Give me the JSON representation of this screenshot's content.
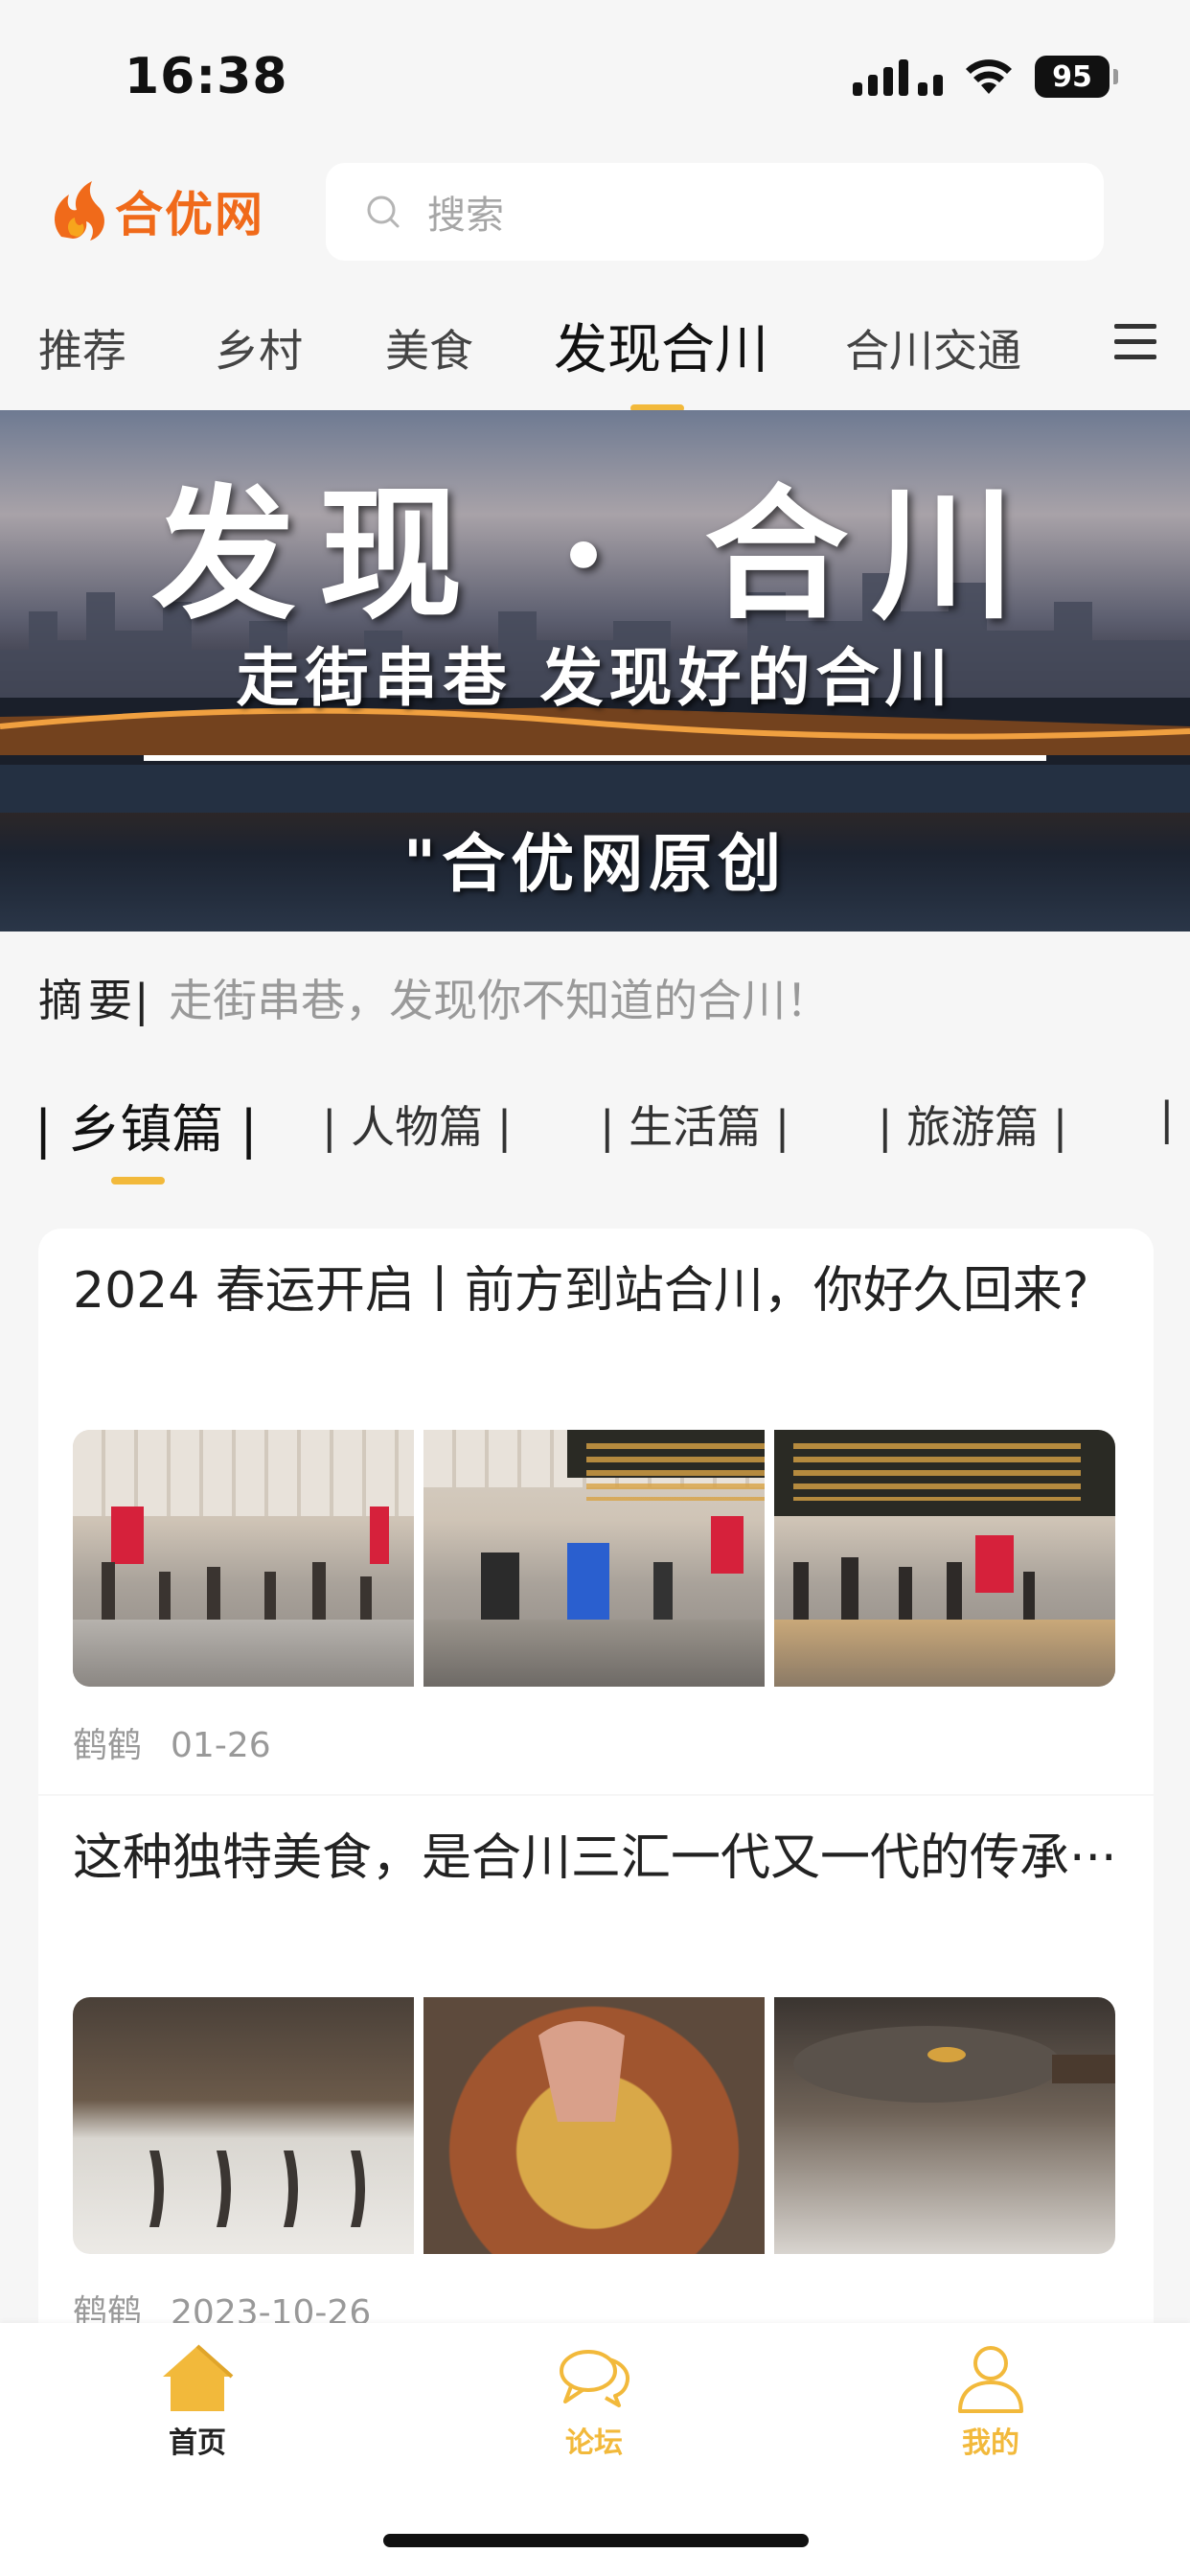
{
  "status_bar": {
    "time": "16:38",
    "battery": "95"
  },
  "header": {
    "logo_text": "合优网",
    "search_placeholder": "搜索"
  },
  "channels": [
    {
      "label": "推荐"
    },
    {
      "label": "乡村"
    },
    {
      "label": "美食"
    },
    {
      "label": "发现合川",
      "active": true
    },
    {
      "label": "合川交通"
    }
  ],
  "banner": {
    "title": "发现 · 合川",
    "subtitle": "走街串巷 发现好的合川",
    "credit": "\"合优网原创"
  },
  "summary": {
    "label": "摘要",
    "separator": "|",
    "text": "走街串巷，发现你不知道的合川！"
  },
  "sections": [
    {
      "label": "| 乡镇篇 |",
      "active": true
    },
    {
      "label": "| 人物篇 |"
    },
    {
      "label": "| 生活篇 |"
    },
    {
      "label": "| 旅游篇 |"
    },
    {
      "label": "|"
    }
  ],
  "articles": [
    {
      "title": "2024 春运开启丨前方到站合川，你好久回来?",
      "author": "鹤鹤",
      "date": "01-26"
    },
    {
      "title": "这种独特美食，是合川三汇一代又一代的传承···",
      "author": "鹤鹤",
      "date": "2023-10-26"
    }
  ],
  "tabbar": {
    "home": "首页",
    "forum": "论坛",
    "me": "我的"
  },
  "colors": {
    "accent": "#f2b93b",
    "logo": "#f06a1a"
  },
  "icons": [
    "search-icon",
    "menu-icon",
    "home-icon",
    "forum-icon",
    "profile-icon"
  ]
}
